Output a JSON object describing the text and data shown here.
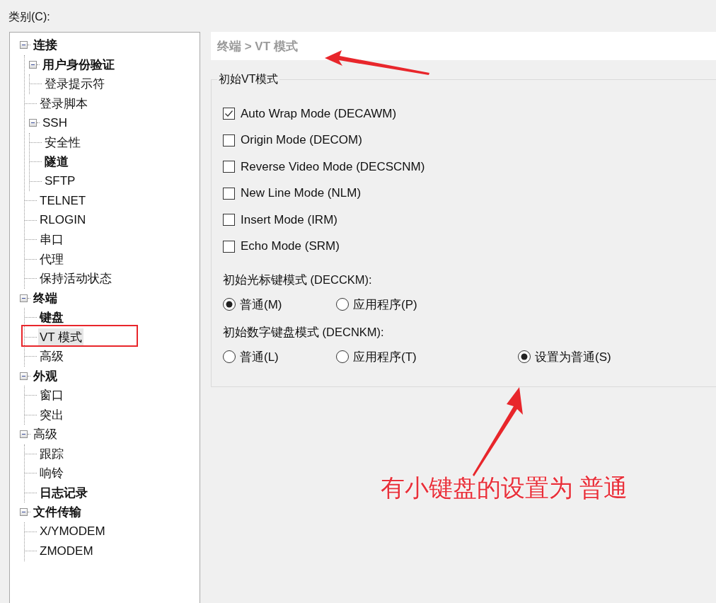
{
  "category_label": "类别(C):",
  "tree": {
    "items": [
      {
        "label": "连接",
        "bold": true,
        "selected": false,
        "expanded": true,
        "children": [
          {
            "label": "用户身份验证",
            "bold": true,
            "selected": false,
            "expanded": true,
            "children": [
              {
                "label": "登录提示符",
                "bold": false,
                "selected": false
              }
            ]
          },
          {
            "label": "登录脚本",
            "bold": false,
            "selected": false
          },
          {
            "label": "SSH",
            "bold": false,
            "selected": false,
            "expanded": true,
            "children": [
              {
                "label": "安全性",
                "bold": false,
                "selected": false
              },
              {
                "label": "隧道",
                "bold": true,
                "selected": false
              },
              {
                "label": "SFTP",
                "bold": false,
                "selected": false
              }
            ]
          },
          {
            "label": "TELNET",
            "bold": false,
            "selected": false
          },
          {
            "label": "RLOGIN",
            "bold": false,
            "selected": false
          },
          {
            "label": "串口",
            "bold": false,
            "selected": false
          },
          {
            "label": "代理",
            "bold": false,
            "selected": false
          },
          {
            "label": "保持活动状态",
            "bold": false,
            "selected": false
          }
        ]
      },
      {
        "label": "终端",
        "bold": true,
        "selected": false,
        "expanded": true,
        "children": [
          {
            "label": "键盘",
            "bold": true,
            "selected": false
          },
          {
            "label": "VT 模式",
            "bold": false,
            "selected": true
          },
          {
            "label": "高级",
            "bold": false,
            "selected": false
          }
        ]
      },
      {
        "label": "外观",
        "bold": true,
        "selected": false,
        "expanded": true,
        "children": [
          {
            "label": "窗口",
            "bold": false,
            "selected": false
          },
          {
            "label": "突出",
            "bold": false,
            "selected": false
          }
        ]
      },
      {
        "label": "高级",
        "bold": false,
        "selected": false,
        "expanded": true,
        "children": [
          {
            "label": "跟踪",
            "bold": false,
            "selected": false
          },
          {
            "label": "响铃",
            "bold": false,
            "selected": false
          },
          {
            "label": "日志记录",
            "bold": true,
            "selected": false
          }
        ]
      },
      {
        "label": "文件传输",
        "bold": true,
        "selected": false,
        "expanded": true,
        "children": [
          {
            "label": "X/YMODEM",
            "bold": false,
            "selected": false
          },
          {
            "label": "ZMODEM",
            "bold": false,
            "selected": false
          }
        ]
      }
    ]
  },
  "breadcrumb": "终端 > VT 模式",
  "group": {
    "title": "初始VT模式",
    "checkboxes": [
      {
        "label": "Auto Wrap Mode (DECAWM)",
        "checked": true
      },
      {
        "label": "Origin Mode (DECOM)",
        "checked": false
      },
      {
        "label": "Reverse Video Mode (DECSCNM)",
        "checked": false
      },
      {
        "label": "New Line Mode (NLM)",
        "checked": false
      },
      {
        "label": "Insert Mode (IRM)",
        "checked": false
      },
      {
        "label": "Echo Mode (SRM)",
        "checked": false
      }
    ],
    "radio_groups": [
      {
        "label": "初始光标键模式 (DECCKM):",
        "options": [
          {
            "label": "普通(M)",
            "selected": true
          },
          {
            "label": "应用程序(P)",
            "selected": false
          }
        ]
      },
      {
        "label": "初始数字键盘模式 (DECNKM):",
        "options": [
          {
            "label": "普通(L)",
            "selected": false
          },
          {
            "label": "应用程序(T)",
            "selected": false
          },
          {
            "label": "设置为普通(S)",
            "selected": true
          }
        ]
      }
    ]
  },
  "annotation_note": "有小键盘的设置为 普通"
}
